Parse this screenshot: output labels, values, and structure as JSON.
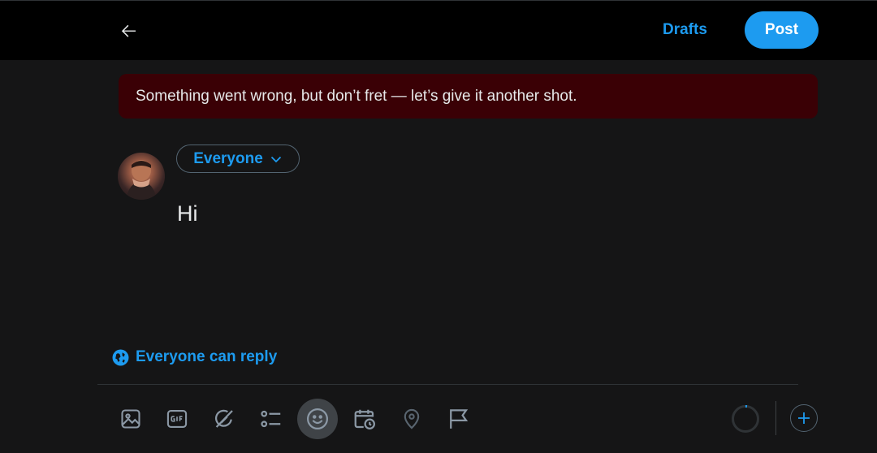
{
  "colors": {
    "accent": "#1d9bf0",
    "background": "#151516",
    "topbar": "#000000",
    "error_bg": "#3a0005",
    "icon_muted": "#8b98a5"
  },
  "header": {
    "drafts_label": "Drafts",
    "post_label": "Post",
    "back_icon": "arrow-left-icon"
  },
  "error_banner": {
    "message": "Something went wrong, but don’t fret — let’s give it another shot."
  },
  "composer": {
    "audience_label": "Everyone",
    "text": "Hi",
    "reply_setting": "Everyone can reply"
  },
  "toolbar": {
    "items": [
      "media-icon",
      "gif-icon",
      "grok-icon",
      "poll-icon",
      "emoji-icon",
      "schedule-icon",
      "location-icon",
      "flag-icon"
    ],
    "active_item": "emoji-icon",
    "char_progress": 0.02,
    "add_icon": "plus-icon"
  }
}
